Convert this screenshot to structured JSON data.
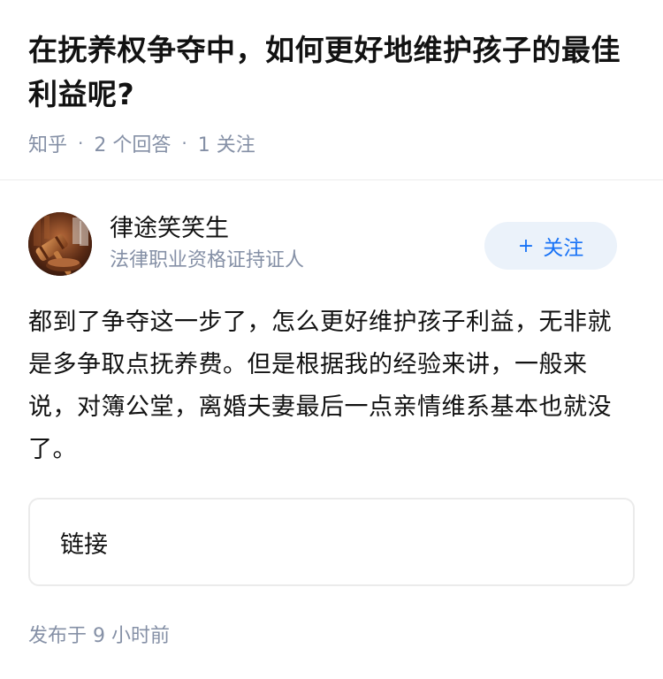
{
  "question": {
    "title": "在抚养权争夺中，如何更好地维护孩子的最佳利益呢?",
    "source": "知乎",
    "answers_count": "2 个回答",
    "followers_count": "1 关注"
  },
  "answer": {
    "author": {
      "name": "律途笑笑生",
      "headline": "法律职业资格证持证人",
      "avatar_icon": "gavel-avatar"
    },
    "follow_button": {
      "icon": "+",
      "label": "关注"
    },
    "content": "都到了争夺这一步了，怎么更好维护孩子利益，无非就是多争取点抚养费。但是根据我的经验来讲，一般来说，对簿公堂，离婚夫妻最后一点亲情维系基本也就没了。",
    "link_card": {
      "label": "链接"
    },
    "publish_time": "发布于 9 小时前"
  },
  "colors": {
    "accent": "#1772f6",
    "button_bg": "#ebf2fa",
    "meta_gray": "#8590a6",
    "text": "#121212"
  }
}
